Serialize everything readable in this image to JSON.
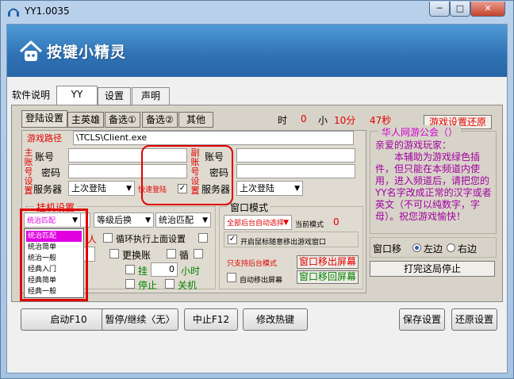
{
  "window": {
    "title": "YY1.0035",
    "min": "─",
    "max": "□",
    "close": "✕"
  },
  "banner": {
    "brand": "按键小精灵"
  },
  "top_tabs": [
    "软件说明",
    "YY",
    "设置",
    "声明"
  ],
  "inner_tabs": [
    "登陆设置",
    "主英雄",
    "备选①",
    "备选②",
    "其他"
  ],
  "timer": {
    "h_label": "时",
    "h_val": "0",
    "m_label": "小",
    "m_val": "10分",
    "s_val": "47秒"
  },
  "restore_button": "游戏设置还原",
  "path": {
    "label": "游戏路径",
    "value": "\\TCLS\\Client.exe"
  },
  "main_account": {
    "side": "主账号设置",
    "account_label": "账号",
    "password_label": "密码",
    "server_label": "服务器",
    "server_value": "上次登陆"
  },
  "alt_account": {
    "side": "副账号设置",
    "account_label": "账号",
    "password_label": "密码",
    "server_label": "服务器",
    "server_value": "上次登陆"
  },
  "quick_login": "快速登陆",
  "hang": {
    "title": "挂机设置",
    "select1": "统治匹配",
    "select2": "等级后换",
    "select3": "统治匹配",
    "loop_label": "循环执行上面设置",
    "change_account": "更换账",
    "loop2": "循",
    "hang_label": "挂",
    "hang_val": "0",
    "hour_label": "小时",
    "stop_label": "停止",
    "shutdown_label": "关机",
    "partial_red": "人",
    "dropdown": [
      "统治匹配",
      "统治简单",
      "统治一般",
      "经典入门",
      "经典简单",
      "经典一般"
    ]
  },
  "window_mode": {
    "title": "窗口模式",
    "select": "全部后台自动选择",
    "current_label": "当前模式",
    "current_val": "0",
    "mouse_label": "开启鼠标随意移出游戏窗口",
    "only_label": "只支持后台模式",
    "move_out": "窗口移出屏幕",
    "auto_move": "自动移出屏幕",
    "move_back": "窗口移回屏幕"
  },
  "club": {
    "title": "华人网游公会（）",
    "text": "亲爱的游戏玩家：\n　　本辅助为游戏绿色插件，但只能在本频道内使用，进入频道后，请把您的YY名字改成正常的汉字或者英文（不可以纯数字，字母）。祝您游戏愉快！"
  },
  "window_move": {
    "label": "窗口移",
    "left": "左边",
    "right": "右边",
    "stop": "打完这局停止"
  },
  "bottom": {
    "start": "启动F10",
    "pause": "暂停/继续〈无〉",
    "stop": "中止F12",
    "hotkey": "修改热键",
    "save": "保存设置",
    "restore": "还原设置"
  }
}
